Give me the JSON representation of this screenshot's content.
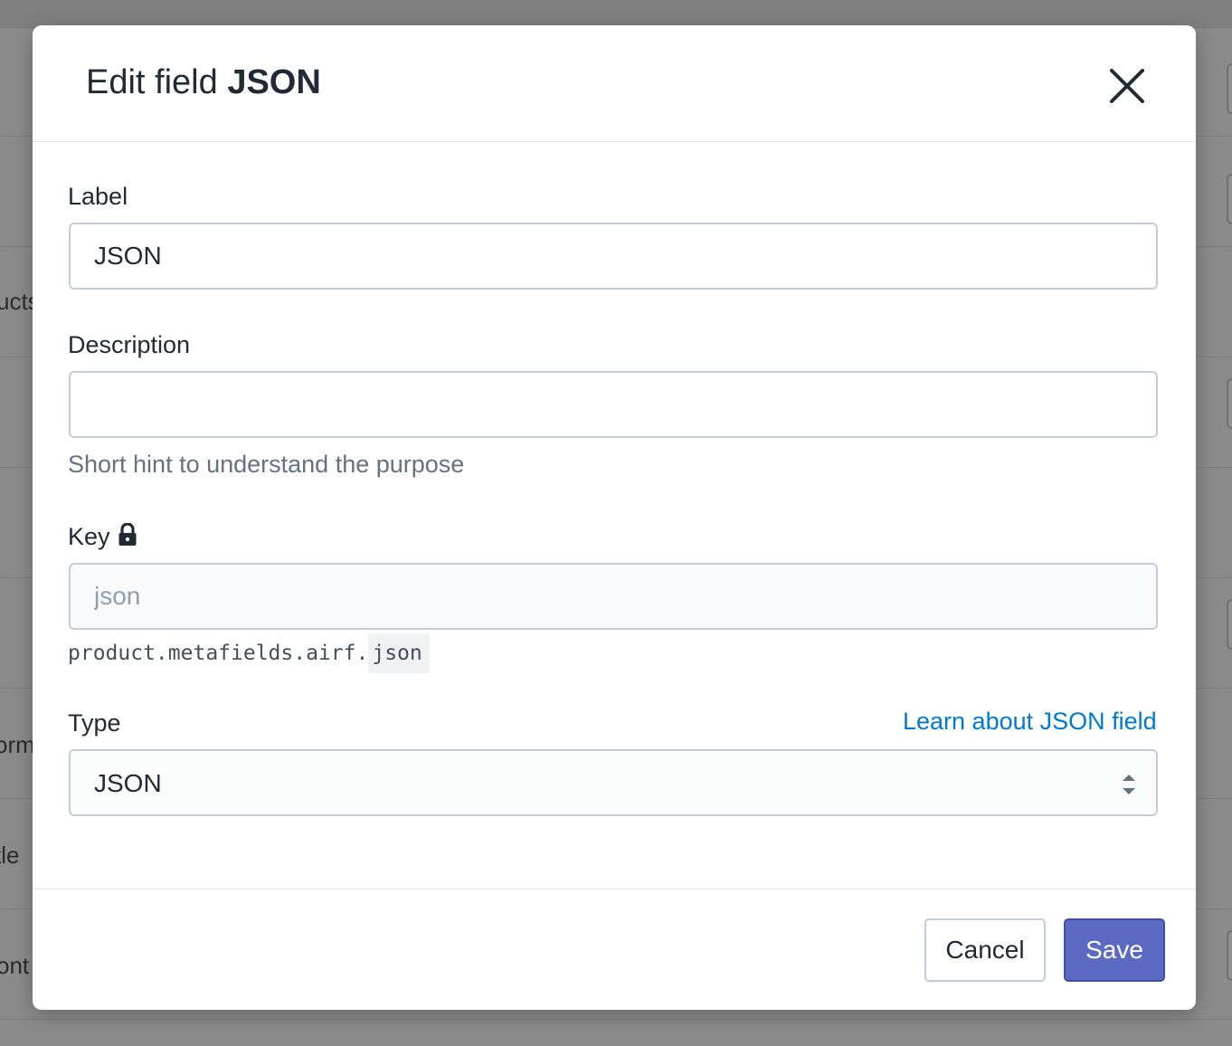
{
  "background": {
    "fragments": [
      "ucts",
      "orm",
      "tle",
      "ont"
    ]
  },
  "modal": {
    "title_prefix": "Edit field ",
    "title_field": "JSON",
    "close_icon": "close-icon",
    "label_field": {
      "label": "Label",
      "value": "JSON"
    },
    "description_field": {
      "label": "Description",
      "value": "",
      "hint": "Short hint to understand the purpose"
    },
    "key_field": {
      "label": "Key",
      "icon": "lock-icon",
      "value": "json",
      "path_prefix": "product.metafields.airf.",
      "path_key": "json"
    },
    "type_field": {
      "label": "Type",
      "learn_link": "Learn about JSON field",
      "selected": "JSON"
    },
    "footer": {
      "cancel_label": "Cancel",
      "save_label": "Save"
    }
  },
  "colors": {
    "primary": "#5c6ac4",
    "link": "#007ace",
    "text": "#212b36",
    "subdued": "#637381",
    "border": "#c4cdd5"
  }
}
